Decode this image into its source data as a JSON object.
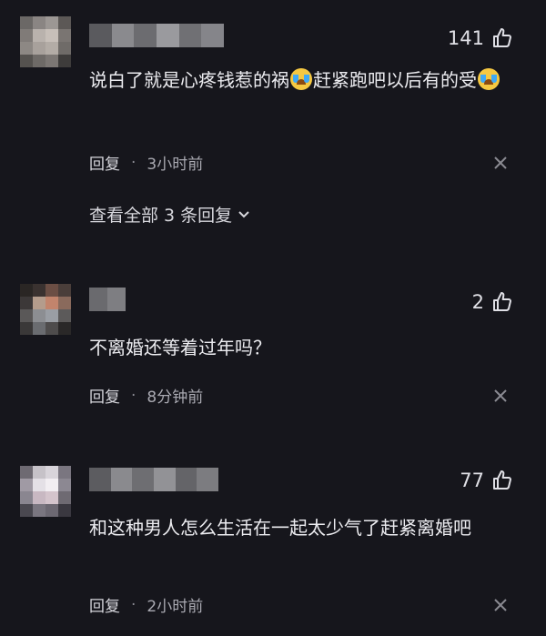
{
  "comments": [
    {
      "likes": "141",
      "text_part1": "说白了就是心疼钱惹的祸",
      "text_part2": "赶紧跑吧以后有的受",
      "reply_label": "回复",
      "separator": "·",
      "time": "3小时前",
      "view_all": "查看全部 3 条回复"
    },
    {
      "likes": "2",
      "text": "不离婚还等着过年吗？",
      "reply_label": "回复",
      "separator": "·",
      "time": "8分钟前"
    },
    {
      "likes": "77",
      "text": "和这种男人怎么生活在一起太少气了赶紧离婚吧",
      "reply_label": "回复",
      "separator": "·",
      "time": "2小时前"
    }
  ],
  "icons": {
    "like": "thumbs-up-icon",
    "close": "close-icon",
    "expand": "chevron-down-icon",
    "emoji": "crying-face-emoji"
  }
}
